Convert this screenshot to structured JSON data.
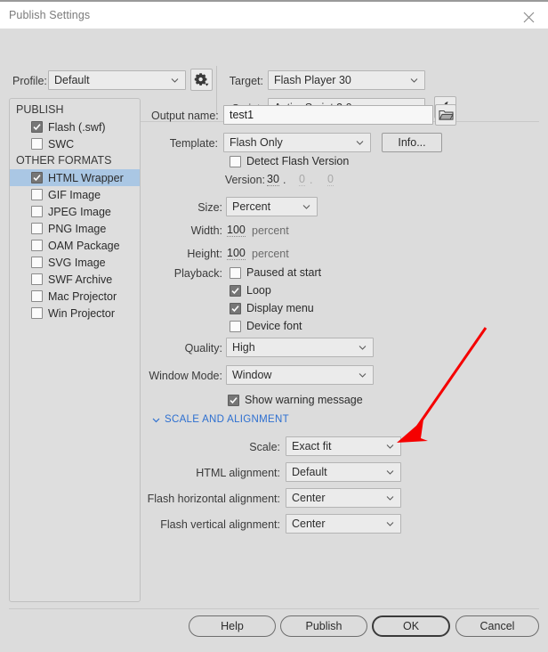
{
  "window": {
    "title": "Publish Settings",
    "close_icon": "close-icon"
  },
  "toolbar": {
    "profile_label": "Profile:",
    "profile_value": "Default",
    "profile_gear_icon": "gear-icon",
    "target_label": "Target:",
    "target_value": "Flash Player 30",
    "script_label": "Script:",
    "script_value": "ActionScript 3.0",
    "script_wrench_icon": "wrench-icon"
  },
  "sidebar": {
    "publish_header": "PUBLISH",
    "other_formats_header": "OTHER FORMATS",
    "publish_items": [
      {
        "label": "Flash (.swf)",
        "checked": true,
        "selected": false
      },
      {
        "label": "SWC",
        "checked": false,
        "selected": false
      }
    ],
    "other_items": [
      {
        "label": "HTML Wrapper",
        "checked": true,
        "selected": true
      },
      {
        "label": "GIF Image",
        "checked": false,
        "selected": false
      },
      {
        "label": "JPEG Image",
        "checked": false,
        "selected": false
      },
      {
        "label": "PNG Image",
        "checked": false,
        "selected": false
      },
      {
        "label": "OAM Package",
        "checked": false,
        "selected": false
      },
      {
        "label": "SVG Image",
        "checked": false,
        "selected": false
      },
      {
        "label": "SWF Archive",
        "checked": false,
        "selected": false
      },
      {
        "label": "Mac Projector",
        "checked": false,
        "selected": false
      },
      {
        "label": "Win Projector",
        "checked": false,
        "selected": false
      }
    ]
  },
  "main": {
    "output_name_label": "Output name:",
    "output_name_value": "test1",
    "browse_icon": "folder-icon",
    "template_label": "Template:",
    "template_value": "Flash Only",
    "info_button": "Info...",
    "detect_flash_version_label": "Detect Flash Version",
    "detect_flash_version_checked": false,
    "version_label": "Version:",
    "version_major": "30",
    "version_dot1": ".",
    "version_minor": "0",
    "version_dot2": ".",
    "version_build": "0",
    "size_label": "Size:",
    "size_value": "Percent",
    "width_label": "Width:",
    "width_value": "100",
    "width_unit": "percent",
    "height_label": "Height:",
    "height_value": "100",
    "height_unit": "percent",
    "playback_label": "Playback:",
    "playback_options": [
      {
        "label": "Paused at start",
        "checked": false
      },
      {
        "label": "Loop",
        "checked": true
      },
      {
        "label": "Display menu",
        "checked": true
      },
      {
        "label": "Device font",
        "checked": false
      }
    ],
    "quality_label": "Quality:",
    "quality_value": "High",
    "window_mode_label": "Window Mode:",
    "window_mode_value": "Window",
    "show_warning_label": "Show warning message",
    "show_warning_checked": true,
    "scale_section_header": "SCALE AND ALIGNMENT",
    "scale_label": "Scale:",
    "scale_value": "Exact fit",
    "html_alignment_label": "HTML alignment:",
    "html_alignment_value": "Default",
    "flash_h_alignment_label": "Flash horizontal alignment:",
    "flash_h_alignment_value": "Center",
    "flash_v_alignment_label": "Flash vertical alignment:",
    "flash_v_alignment_value": "Center"
  },
  "footer": {
    "help": "Help",
    "publish": "Publish",
    "ok": "OK",
    "cancel": "Cancel"
  },
  "annotation": {
    "type": "arrow",
    "color": "#f50000",
    "points_to": "scale-dropdown"
  }
}
